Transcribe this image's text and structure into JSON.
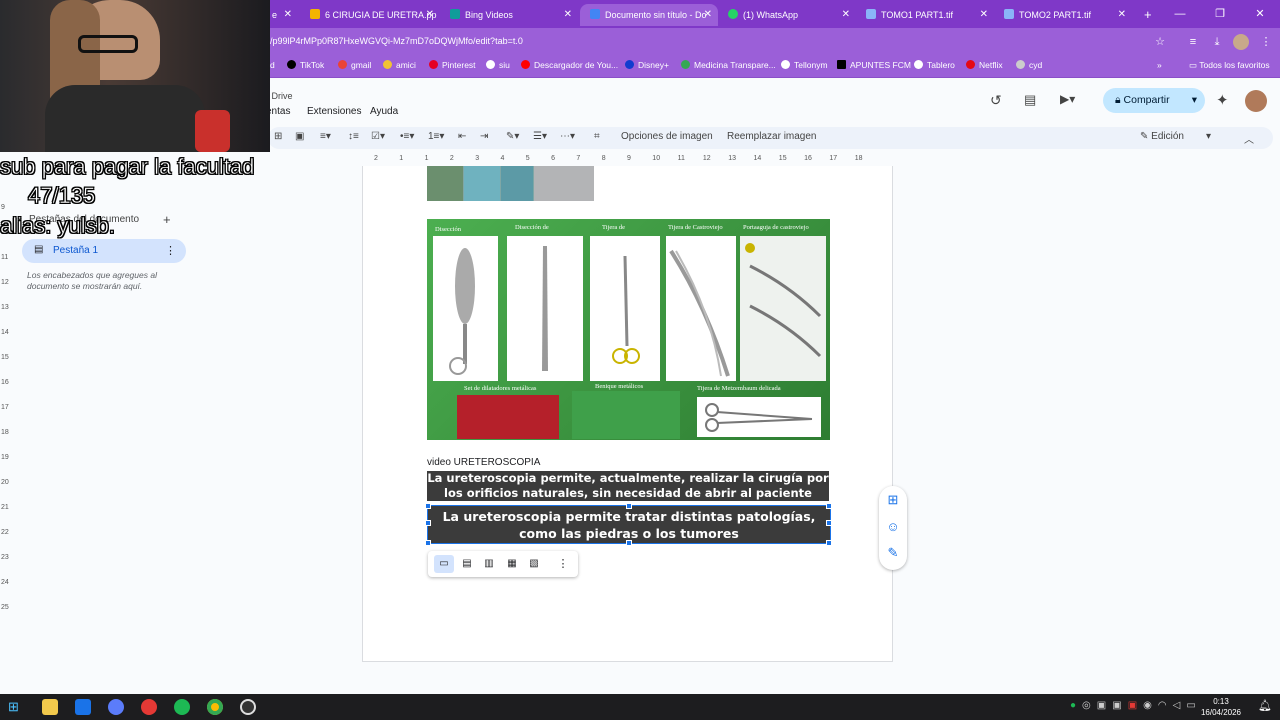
{
  "browser": {
    "tabs": [
      {
        "label": "e",
        "fav": "#e8eaed"
      },
      {
        "label": "6 CIRUGIA DE URETRA.pp",
        "fav": "#f4b400"
      },
      {
        "label": "Bing Videos",
        "fav": "#0f9d9a"
      },
      {
        "label": "Documento sin título - Do",
        "fav": "#4285f4"
      },
      {
        "label": "(1) WhatsApp",
        "fav": "#25d366"
      },
      {
        "label": "TOMO1 PART1.tif",
        "fav": "#8ab4f8"
      },
      {
        "label": "TOMO2 PART1.tif",
        "fav": "#8ab4f8"
      }
    ],
    "new_tab": "+",
    "url": "/p99lP4rMPp0R87HxeWGVQi-Mz7mD7oDQWjMfo/edit?tab=t.0",
    "bookmarks": [
      "d",
      "TikTok",
      "gmail",
      "amici",
      "Pinterest",
      "siu",
      "Descargador de You...",
      "Disney+",
      "Medicina Transpare...",
      "Tellonym",
      "APUNTES FCM",
      "Tablero",
      "Netflix",
      "cyd"
    ],
    "all_bookmarks": "Todos los favoritos"
  },
  "docs": {
    "drive_label": "n Drive",
    "menus": [
      "entas",
      "Extensiones",
      "Ayuda"
    ],
    "share_label": "Compartir",
    "toolbar": {
      "image_options": "Opciones de imagen",
      "replace_image": "Reemplazar imagen",
      "mode": "Edición"
    },
    "ruler_ticks": [
      "2",
      "1",
      "1",
      "2",
      "3",
      "4",
      "5",
      "6",
      "7",
      "8",
      "9",
      "10",
      "11",
      "12",
      "13",
      "14",
      "15",
      "16",
      "17",
      "18"
    ],
    "vruler_ticks": [
      "9",
      "10",
      "11",
      "12",
      "13",
      "14",
      "15",
      "16",
      "17",
      "18",
      "19",
      "20",
      "21",
      "22",
      "23",
      "24",
      "25"
    ],
    "sidebar": {
      "section_title": "Pestañas del documento",
      "add": "+",
      "tab_label": "Pestaña 1",
      "hint": "Los encabezados que agregues al documento se mostrarán aquí."
    },
    "doc_text": "video URETEROSCOPIA",
    "instrument_captions": [
      "Disección",
      "Disección de",
      "Tijera de",
      "Tijera de Castroviejo",
      "Portaaguja de castroviejo",
      "Set de dilatadores metálicas",
      "Benique metálicos",
      "Tijera de Metzembaum delicada"
    ],
    "subtitle1": [
      "La ureteroscopia permite, actualmente, realizar la cirugía por",
      "los orificios  naturales, sin necesidad de abrir al paciente"
    ],
    "subtitle2": [
      "La ureteroscopia permite tratar distintas patologías,",
      "como las piedras o los tumores"
    ]
  },
  "stream_overlay": {
    "line1": "sub para pagar la facultad",
    "line2": "47/135",
    "line3": "alias: yulsb."
  },
  "taskbar": {
    "time": "0:13",
    "date": "16/04/2026"
  }
}
